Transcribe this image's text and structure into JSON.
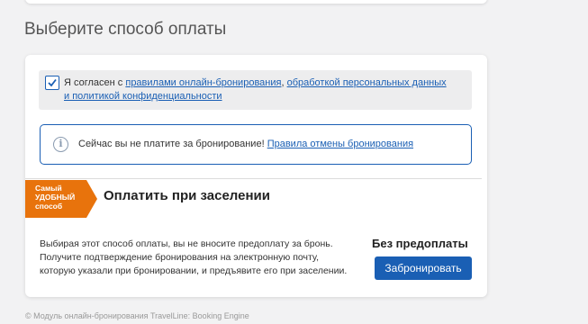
{
  "section_title": "Выберите способ оплаты",
  "consent": {
    "checked": true,
    "prefix": "Я согласен с ",
    "link_rules": "правилами онлайн-бронирования",
    "sep": ", ",
    "link_personal_data": "обработкой персональных данных",
    "link_privacy": "и политикой конфиденциальности"
  },
  "info": {
    "text": "Сейчас вы не платите за бронирование! ",
    "link_cancel": "Правила отмены бронирования"
  },
  "option": {
    "badge": [
      "Самый",
      "УДОБНЫЙ",
      "способ"
    ],
    "title": "Оплатить при заселении",
    "description": "Выбирая этот способ оплаты, вы не вносите предоплату за бронь. Получите подтверждение бронирования на электронную почту, которую указали при бронировании, и предъявите его при заселении.",
    "price_label": "Без предоплаты",
    "book_button": "Забронировать"
  },
  "footer": "© Модуль онлайн-бронирования TravelLine: Booking Engine",
  "colors": {
    "accent": "#1a5fb4",
    "badge": "#e8730c",
    "background": "#f2f2f3"
  }
}
